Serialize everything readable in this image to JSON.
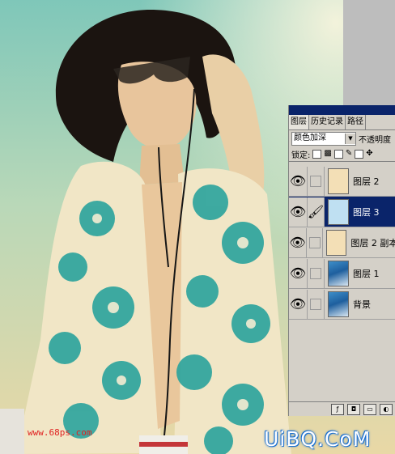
{
  "layers_panel": {
    "tabs": [
      {
        "label": "图层"
      },
      {
        "label": "历史记录"
      },
      {
        "label": "路径"
      }
    ],
    "blend_mode": "颜色加深",
    "opacity_label": "不透明度",
    "lock_label": "锁定:",
    "layers": [
      {
        "name": "图层 2",
        "thumb": "#f3dfb6",
        "selected": false,
        "brush": false
      },
      {
        "name": "图层 3",
        "thumb": "#bfe0f2",
        "selected": true,
        "brush": true
      },
      {
        "name": "图层 2 副本",
        "thumb": "#f3dfb6",
        "selected": false,
        "brush": false
      },
      {
        "name": "图层 1",
        "thumb": "photo",
        "selected": false,
        "brush": false
      },
      {
        "name": "背景",
        "thumb": "photo",
        "selected": false,
        "brush": false
      }
    ]
  },
  "watermarks": {
    "site_small": "www.68ps.com",
    "site_big": "UiBQ.CoM"
  },
  "colors": {
    "panel_bg": "#d4d0c8",
    "selection": "#0a246a"
  }
}
